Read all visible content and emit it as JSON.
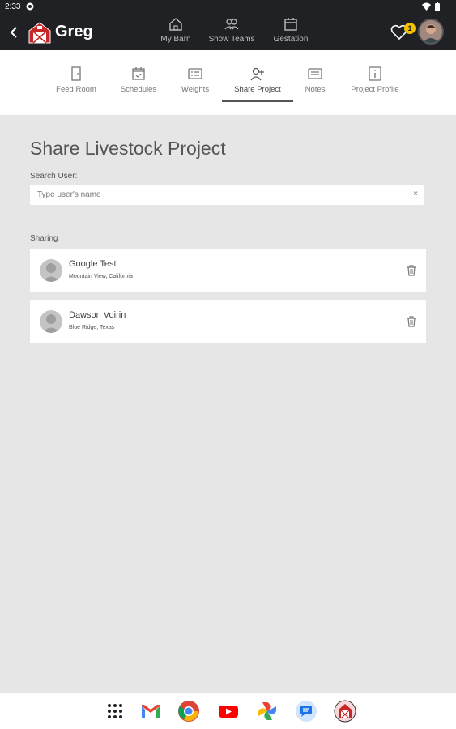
{
  "status_bar": {
    "time": "2:33"
  },
  "app_bar": {
    "user_name": "Greg",
    "nav": [
      "My Barn",
      "Show Teams",
      "Gestation"
    ],
    "notification_count": "1"
  },
  "tabs": [
    {
      "label": "Feed Room",
      "icon": "door-icon"
    },
    {
      "label": "Schedules",
      "icon": "calendar-check-icon"
    },
    {
      "label": "Weights",
      "icon": "scale-icon"
    },
    {
      "label": "Share Project",
      "icon": "person-add-icon",
      "active": true
    },
    {
      "label": "Notes",
      "icon": "notes-icon"
    },
    {
      "label": "Project Profile",
      "icon": "info-icon"
    }
  ],
  "page": {
    "title": "Share Livestock Project",
    "search_label": "Search User:",
    "search_placeholder": "Type user's name",
    "search_clear": "×",
    "sharing_label": "Sharing"
  },
  "shared_users": [
    {
      "name": "Google Test",
      "location": "Mountain View, California"
    },
    {
      "name": "Dawson Voirin",
      "location": "Blue Ridge, Texas"
    }
  ],
  "dock_apps": [
    "apps-grid-icon",
    "gmail-icon",
    "chrome-icon",
    "youtube-icon",
    "photos-icon",
    "messages-icon",
    "barn-app-icon"
  ],
  "colors": {
    "app_bar": "#202124",
    "background": "#e6e6e6",
    "card": "#ffffff",
    "badge": "#f4c000"
  }
}
